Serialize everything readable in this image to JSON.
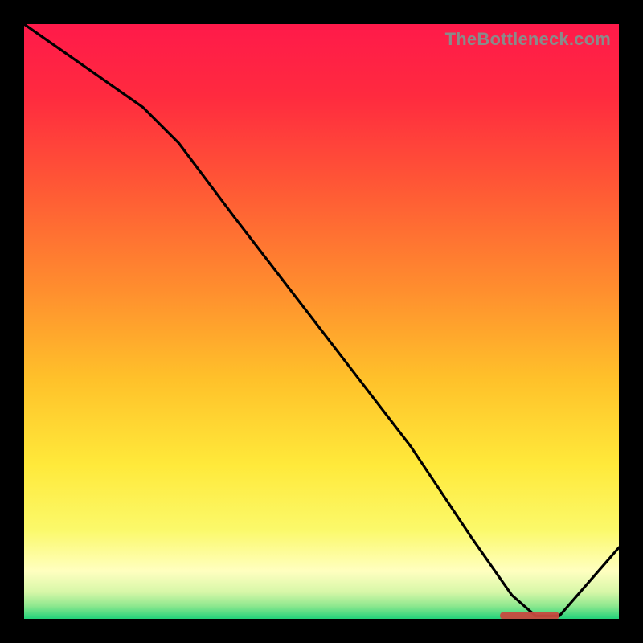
{
  "watermark": "TheBottleneck.com",
  "colors": {
    "frame": "#000000",
    "watermark": "#8a8a8a",
    "curve": "#000000",
    "marker": "#c74a3f",
    "gradient_stops": [
      {
        "offset": 0.0,
        "color": "#ff1a4a"
      },
      {
        "offset": 0.12,
        "color": "#ff2a3f"
      },
      {
        "offset": 0.28,
        "color": "#ff5a35"
      },
      {
        "offset": 0.45,
        "color": "#ff8f2e"
      },
      {
        "offset": 0.6,
        "color": "#ffc22a"
      },
      {
        "offset": 0.74,
        "color": "#ffe93a"
      },
      {
        "offset": 0.85,
        "color": "#fbf96a"
      },
      {
        "offset": 0.92,
        "color": "#ffffc0"
      },
      {
        "offset": 0.955,
        "color": "#d7f7a8"
      },
      {
        "offset": 0.978,
        "color": "#8fe88f"
      },
      {
        "offset": 1.0,
        "color": "#22d27a"
      }
    ]
  },
  "chart_data": {
    "type": "line",
    "title": "",
    "xlabel": "",
    "ylabel": "",
    "xlim": [
      0,
      100
    ],
    "ylim": [
      0,
      100
    ],
    "series": [
      {
        "name": "bottleneck-curve",
        "x": [
          0,
          10,
          20,
          26,
          35,
          45,
          55,
          65,
          75,
          82,
          86,
          90,
          100
        ],
        "y": [
          100,
          93,
          86,
          80,
          68,
          55,
          42,
          29,
          14,
          4,
          0.5,
          0.5,
          12
        ]
      }
    ],
    "annotations": [
      {
        "name": "optimal-range-marker",
        "x_start": 80,
        "x_end": 90,
        "y": 0.5
      }
    ]
  }
}
